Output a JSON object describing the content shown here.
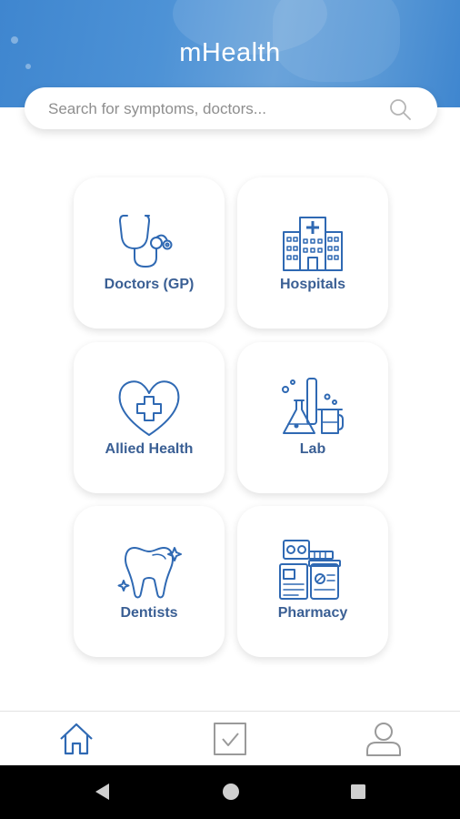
{
  "app": {
    "title": "mHealth"
  },
  "search": {
    "placeholder": "Search for symptoms, doctors..."
  },
  "categories": [
    {
      "label": "Doctors (GP)",
      "icon": "stethoscope-icon"
    },
    {
      "label": "Hospitals",
      "icon": "hospital-icon"
    },
    {
      "label": "Allied Health",
      "icon": "heart-cross-icon"
    },
    {
      "label": "Lab",
      "icon": "lab-flask-icon"
    },
    {
      "label": "Dentists",
      "icon": "tooth-icon"
    },
    {
      "label": "Pharmacy",
      "icon": "pharmacy-icon"
    }
  ],
  "bottom_nav": [
    {
      "icon": "home-icon",
      "active": true
    },
    {
      "icon": "checkbox-icon",
      "active": false
    },
    {
      "icon": "user-icon",
      "active": false
    }
  ],
  "colors": {
    "header": "#4a8fd4",
    "accent": "#2f69b3",
    "label": "#3a5f94"
  }
}
